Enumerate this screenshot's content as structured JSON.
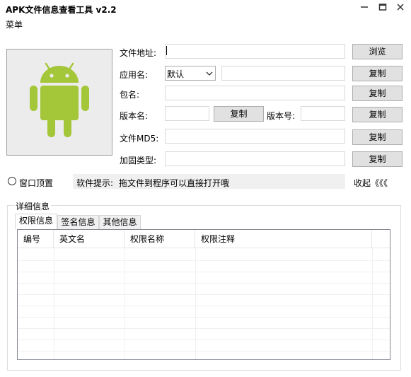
{
  "window": {
    "title": "APK文件信息查看工具 v2.2",
    "controls": [
      "minimize-icon",
      "maximize-icon",
      "close-icon"
    ]
  },
  "menu": {
    "label": "菜单"
  },
  "fields": {
    "file_path_label": "文件地址:",
    "app_name_label": "应用名:",
    "app_name_select_value": "默认",
    "package_label": "包名:",
    "version_name_label": "版本名:",
    "version_code_label": "版本号:",
    "md5_label": "文件MD5:",
    "protection_label": "加固类型:"
  },
  "buttons": {
    "browse": "浏览",
    "copy": "复制"
  },
  "options": {
    "topmost_label": "窗口顶置",
    "tip_label": "软件提示:",
    "tip_text": "拖文件到程序可以直接打开哦",
    "collapse_label": "收起《《《"
  },
  "details": {
    "group_label": "详细信息",
    "tabs": [
      "权限信息",
      "签名信息",
      "其他信息"
    ],
    "active_tab": 0,
    "columns": [
      "编号",
      "英文名",
      "权限名称",
      "权限注释"
    ]
  },
  "colors": {
    "android_green": "#a4c639",
    "icon_bg": "#ececec",
    "button_bg": "#e1e1e1"
  }
}
